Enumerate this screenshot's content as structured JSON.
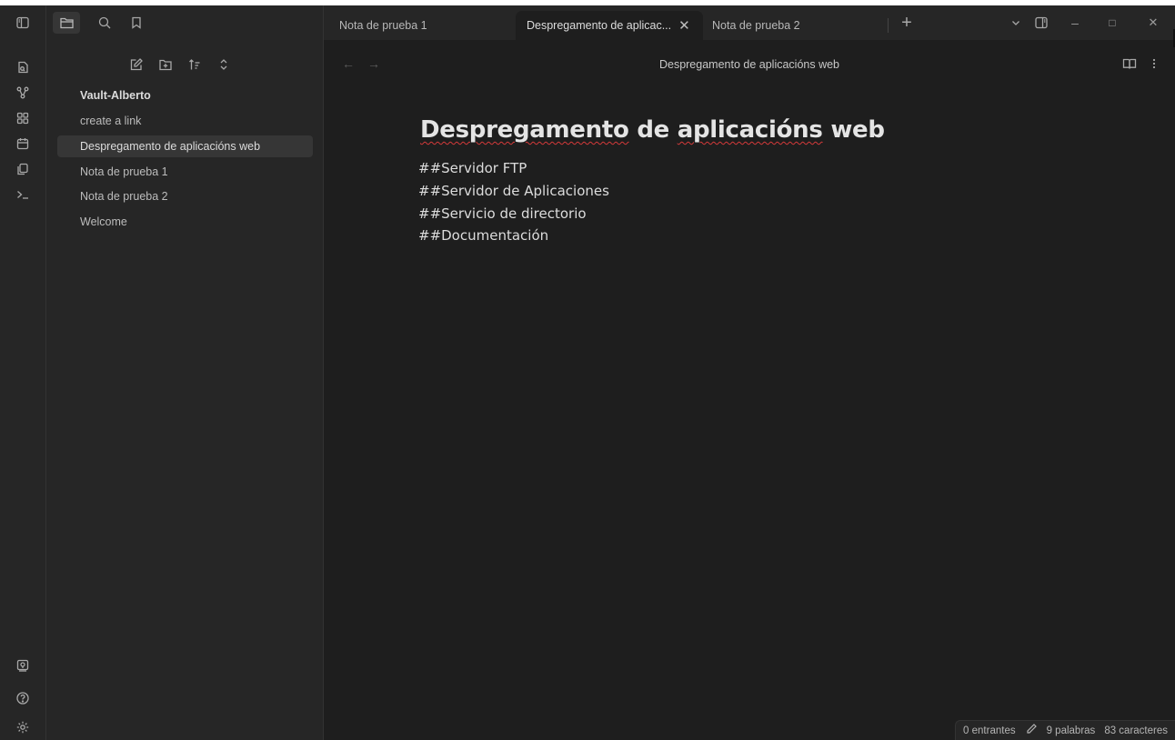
{
  "tabs": [
    {
      "label": "Nota de prueba 1"
    },
    {
      "label": "Despregamento de aplicac..."
    },
    {
      "label": "Nota de prueba 2"
    }
  ],
  "tab_close_glyph": "✕",
  "new_tab_glyph": "+",
  "window": {
    "minimize": "–",
    "maximize": "□",
    "close": "✕"
  },
  "explorer": {
    "vault_name": "Vault-Alberto",
    "files": [
      {
        "name": "create a link"
      },
      {
        "name": "Despregamento de aplicacións web"
      },
      {
        "name": "Nota de prueba 1"
      },
      {
        "name": "Nota de prueba 2"
      },
      {
        "name": "Welcome"
      }
    ]
  },
  "editor": {
    "view_title": "Despregamento de aplicacións web",
    "heading_parts": [
      "Despregamento",
      "de",
      "aplicacións",
      "web"
    ],
    "lines": [
      "##Servidor FTP",
      "##Servidor de Aplicaciones",
      "##Servicio de directorio",
      "##Documentación"
    ],
    "back_arrow": "←",
    "forward_arrow": "→"
  },
  "status": {
    "backlinks": "0 entrantes",
    "words": "9 palabras",
    "chars": "83 caracteres"
  },
  "icons": {
    "ribbon_top": [
      "sidebar-toggle-icon"
    ],
    "tabs_bar": [
      "files-icon",
      "search-icon",
      "bookmark-icon"
    ],
    "ribbon": [
      "quick-switcher-icon",
      "graph-icon",
      "canvas-icon",
      "daily-note-icon",
      "templates-icon",
      "command-palette-icon"
    ],
    "ribbon_bottom": [
      "vault-switcher-icon",
      "help-icon",
      "settings-icon"
    ]
  }
}
